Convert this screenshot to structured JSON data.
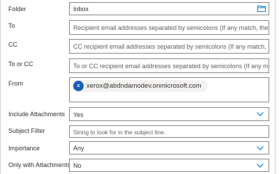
{
  "folder": {
    "label": "Folder",
    "value": "Inbox",
    "icon": "folder-icon"
  },
  "to": {
    "label": "To",
    "placeholder": "Recipient email addresses separated by semicolons (If any match, the"
  },
  "cc": {
    "label": "CC",
    "placeholder": "CC recipient email addresses separated by semicolons (If any match,"
  },
  "to_or_cc": {
    "label": "To or CC",
    "placeholder": "To or CC recipient email addresses separated by semicolons (If any m"
  },
  "from": {
    "label": "From",
    "chip": {
      "initial": "x",
      "email": "xerox@abdndamodev.onmicrosoft.com",
      "avatar_color": "#1a5fb4"
    }
  },
  "include_attachments": {
    "label": "Include Attachments",
    "value": "Yes",
    "icon": "chevron-down-icon"
  },
  "subject_filter": {
    "label": "Subject Filter",
    "placeholder": "String to look for in the subject line."
  },
  "importance": {
    "label": "Importance",
    "value": "Any",
    "icon": "chevron-down-icon"
  },
  "only_with_attachments": {
    "label": "Only with Attachments",
    "value": "No",
    "icon": "chevron-down-icon"
  },
  "colors": {
    "accent": "#0078d4",
    "border": "#8a8886",
    "chip_bg": "#f3f2f1"
  }
}
